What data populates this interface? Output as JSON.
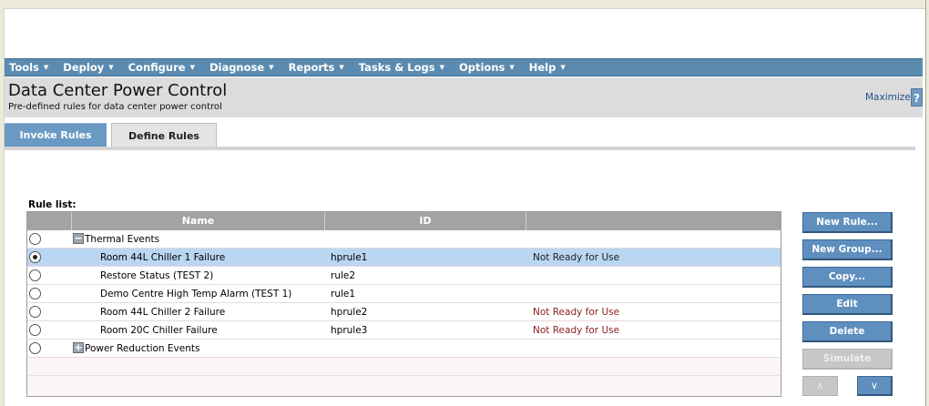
{
  "menu": {
    "items": [
      {
        "label": "Tools"
      },
      {
        "label": "Deploy"
      },
      {
        "label": "Configure"
      },
      {
        "label": "Diagnose"
      },
      {
        "label": "Reports"
      },
      {
        "label": "Tasks & Logs"
      },
      {
        "label": "Options"
      },
      {
        "label": "Help"
      }
    ],
    "caret": "▼"
  },
  "header": {
    "title": "Data Center Power Control",
    "subtitle": "Pre-defined rules for data center power control",
    "maximize": "Maximize",
    "help": "?"
  },
  "tabs": [
    {
      "label": "Invoke Rules",
      "active": false
    },
    {
      "label": "Define Rules",
      "active": true
    }
  ],
  "rule_list": {
    "label": "Rule list:",
    "columns": {
      "name": "Name",
      "id": "ID",
      "status": ""
    },
    "groups": [
      {
        "label": "Thermal Events",
        "toggle": "−",
        "expanded": true,
        "rules": [
          {
            "name": "Room 44L Chiller 1 Failure",
            "id": "hprule1",
            "status": "Not Ready for Use",
            "selected": true
          },
          {
            "name": "Restore Status (TEST 2)",
            "id": "rule2",
            "status": "",
            "selected": false
          },
          {
            "name": "Demo Centre High Temp Alarm (TEST 1)",
            "id": "rule1",
            "status": "",
            "selected": false
          },
          {
            "name": "Room 44L Chiller 2 Failure",
            "id": "hprule2",
            "status": "Not Ready for Use",
            "selected": false
          },
          {
            "name": "Room 20C Chiller Failure",
            "id": "hprule3",
            "status": "Not Ready for Use",
            "selected": false
          }
        ]
      },
      {
        "label": "Power Reduction Events",
        "toggle": "+",
        "expanded": false,
        "rules": []
      }
    ]
  },
  "actions": {
    "new_rule": "New Rule...",
    "new_group": "New Group...",
    "copy": "Copy...",
    "edit": "Edit",
    "delete": "Delete",
    "simulate": "Simulate",
    "move_up": "∧",
    "move_down": "∨"
  },
  "colors": {
    "menu_bg": "#5b8bb0",
    "title_bg": "#dcdcdc",
    "button_bg": "#5f8fbe",
    "selected_row": "#b9d6f2",
    "status_text": "#8a1f1f"
  }
}
